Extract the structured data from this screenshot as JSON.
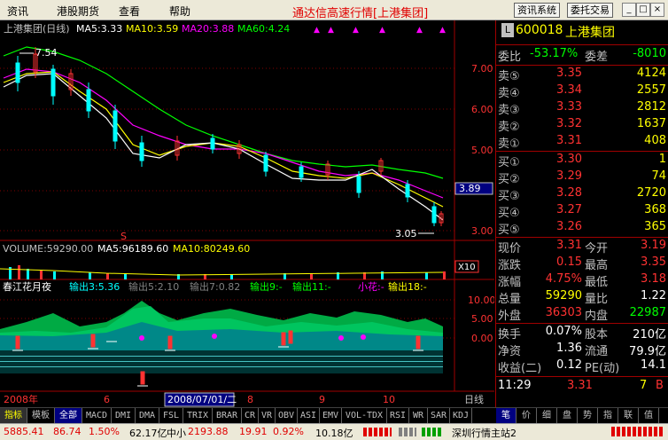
{
  "menu": {
    "items": [
      "资讯",
      "港股期货",
      "查看",
      "帮助"
    ],
    "title": "通达信高速行情[上港集团]",
    "buttons": [
      "资讯系统",
      "委托交易"
    ]
  },
  "header": {
    "stock_line": "上港集团(日线)",
    "ma5": "MA5:3.33",
    "ma10": "MA10:3.59",
    "ma20": "MA20:3.88",
    "ma60": "MA60:4.24"
  },
  "price_panel": {
    "high_label": "7.54",
    "low_label": "3.05",
    "current_badge": "3.89",
    "y_ticks": [
      "7.00",
      "6.00",
      "5.00",
      "4.00",
      "3.00"
    ],
    "marker": "S"
  },
  "volume_panel": {
    "label": "VOLUME:59290.00",
    "ma5": "MA5:96189.60",
    "ma10": "MA10:80249.60",
    "unit": "X10"
  },
  "indicator_panel": {
    "name": "春江花月夜",
    "out1": "输出3:5.36",
    "out2": "输出5:2.10",
    "out3": "输出7:0.82",
    "out4": "输出9:-",
    "out5": "输出11:-",
    "out6": "小花:-",
    "out7": "输出18:-",
    "y_ticks": [
      "10.00",
      "5.00",
      "0.00"
    ]
  },
  "time_axis": {
    "year": "2008年",
    "m6": "6",
    "date_box": "2008/07/01/二",
    "m8": "8",
    "m9": "9",
    "m10": "10",
    "period": "日线"
  },
  "quote": {
    "code": "600018",
    "name": "上港集团",
    "L_badge": "L",
    "weibi_label": "委比",
    "weibi": "-53.17%",
    "weicha_label": "委差",
    "weicha": "-8010",
    "sell": [
      {
        "label": "卖⑤",
        "price": "3.35",
        "vol": "4124"
      },
      {
        "label": "卖④",
        "price": "3.34",
        "vol": "2557"
      },
      {
        "label": "卖③",
        "price": "3.33",
        "vol": "2812"
      },
      {
        "label": "卖②",
        "price": "3.32",
        "vol": "1637"
      },
      {
        "label": "卖①",
        "price": "3.31",
        "vol": "408"
      }
    ],
    "buy": [
      {
        "label": "买①",
        "price": "3.30",
        "vol": "1"
      },
      {
        "label": "买②",
        "price": "3.29",
        "vol": "74"
      },
      {
        "label": "买③",
        "price": "3.28",
        "vol": "2720"
      },
      {
        "label": "买④",
        "price": "3.27",
        "vol": "368"
      },
      {
        "label": "买⑤",
        "price": "3.26",
        "vol": "365"
      }
    ],
    "stats": [
      {
        "l1": "现价",
        "v1": "3.31",
        "l2": "今开",
        "v2": "3.19"
      },
      {
        "l1": "涨跌",
        "v1": "0.15",
        "l2": "最高",
        "v2": "3.35"
      },
      {
        "l1": "涨幅",
        "v1": "4.75%",
        "l2": "最低",
        "v2": "3.18"
      },
      {
        "l1": "总量",
        "v1": "59290",
        "l2": "量比",
        "v2": "1.22"
      },
      {
        "l1": "外盘",
        "v1": "36303",
        "l2": "内盘",
        "v2": "22987"
      }
    ],
    "stats2": [
      {
        "l1": "换手",
        "v1": "0.07%",
        "l2": "股本",
        "v2": "210亿"
      },
      {
        "l1": "净资",
        "v1": "1.36",
        "l2": "流通",
        "v2": "79.9亿"
      },
      {
        "l1": "收益(二)",
        "v1": "0.12",
        "l2": "PE(动)",
        "v2": "14.1"
      }
    ],
    "tick": {
      "time": "11:29",
      "price": "3.31",
      "vol": "7",
      "side": "B"
    },
    "tabs": [
      "笔",
      "价",
      "细",
      "盘",
      "势",
      "指",
      "联",
      "值"
    ]
  },
  "tabbar": {
    "tabs": [
      "指标",
      "模板",
      "全部",
      "MACD",
      "DMI",
      "DMA",
      "FSL",
      "TRIX",
      "BRAR",
      "CR",
      "VR",
      "OBV",
      "ASI",
      "EMV",
      "VOL-TDX",
      "RSI",
      "WR",
      "SAR",
      "KDJ"
    ]
  },
  "statusbar": {
    "sh_index": "5885.41",
    "sh_change": "86.74",
    "sh_pct": "1.50%",
    "sh_amount": "62.17亿",
    "zx_label": "中小",
    "zx_index": "2193.88",
    "zx_change": "19.91",
    "zx_pct": "0.92%",
    "zx_amount": "10.18亿",
    "server": "深圳行情主站2"
  },
  "colors": {
    "up": "#ff3232",
    "down": "#00ffff",
    "ma5": "#ffffff",
    "ma10": "#ffff00",
    "ma20": "#ff00ff",
    "ma60": "#00ff00",
    "axis": "#a00000"
  }
}
